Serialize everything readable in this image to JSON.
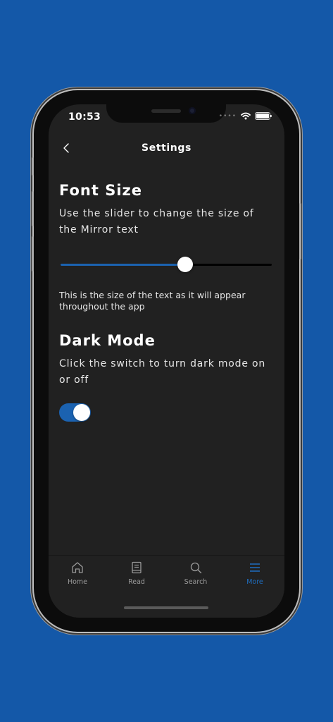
{
  "status": {
    "time": "10:53"
  },
  "header": {
    "title": "Settings"
  },
  "font_size": {
    "heading": "Font Size",
    "description": "Use the slider to change the size of the Mirror text",
    "slider_value": 0.59,
    "preview": "This is the size of the text as it will appear throughout the app"
  },
  "dark_mode": {
    "heading": "Dark Mode",
    "description": "Click the switch to turn dark mode on or off",
    "enabled": true
  },
  "tabs": [
    {
      "label": "Home",
      "icon": "home-icon",
      "active": false
    },
    {
      "label": "Read",
      "icon": "book-icon",
      "active": false
    },
    {
      "label": "Search",
      "icon": "search-icon",
      "active": false
    },
    {
      "label": "More",
      "icon": "menu-icon",
      "active": true
    }
  ],
  "colors": {
    "accent": "#1b62b0",
    "background": "#1458a8",
    "screen": "#212121"
  }
}
